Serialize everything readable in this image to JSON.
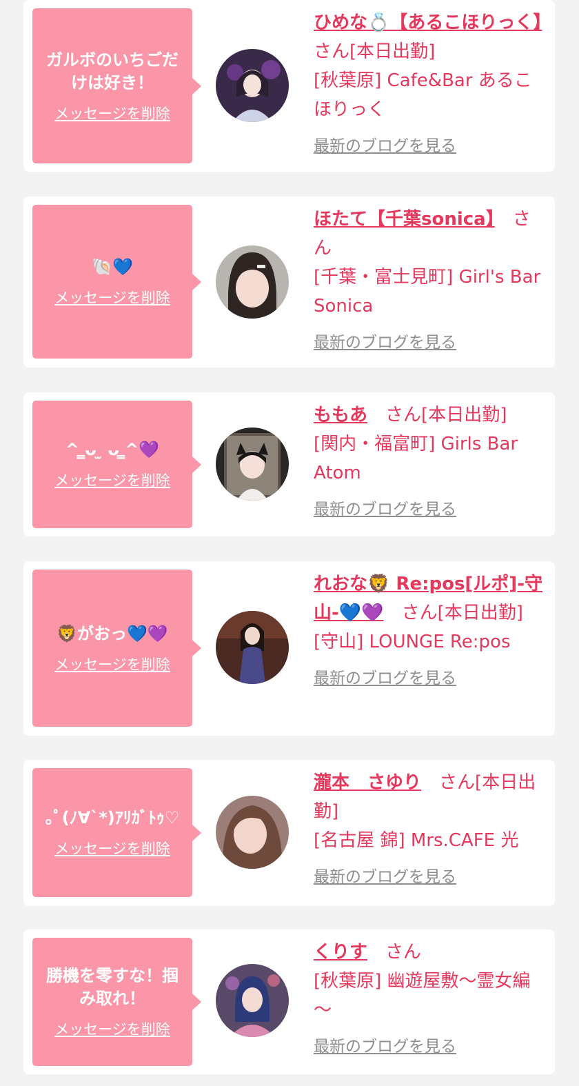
{
  "delete_label": "メッセージを削除",
  "san_label": "さん",
  "blog_label": "最新のブログを見る",
  "colors": {
    "bubble": "#fa96a8",
    "name": "#e4385c",
    "link_gray": "#8e8e8e",
    "background": "#f3f3f3"
  },
  "entries": [
    {
      "message": "ガルボのいちごだけは好き！",
      "name": "ひめな💍【あるこほりっく】",
      "status": "[本日出勤]",
      "shop": "[秋葉原] Cafe&Bar あるこほりっく"
    },
    {
      "message": "🐚💙",
      "name": "ほたて【千葉sonica】",
      "status": "",
      "shop": "[千葉・富士見町] Girl's Bar Sonica"
    },
    {
      "message": "^ ̳ᴗ ̫ ᴗ ̳^💜",
      "name": "ももあ",
      "status": "[本日出勤]",
      "shop": "[関内・福富町] Girls Bar Atom"
    },
    {
      "message": "🦁がおっ💙💜",
      "name": "れおな🦁 Re:pos[ルポ]-守山-💙💜",
      "status": "[本日出勤]",
      "shop": "[守山] LOUNGE Re:pos"
    },
    {
      "message": "｡ﾟ(ﾉ∀`*)ｱﾘｶﾞﾄｩ♡",
      "name": "瀧本　さゆり",
      "status": "[本日出勤]",
      "shop": "[名古屋 錦] Mrs.CAFE 光"
    },
    {
      "message": "勝機を零すな！掴み取れ！",
      "name": "くりす",
      "status": "",
      "shop": "[秋葉原] 幽遊屋敷～霊女編～"
    }
  ]
}
